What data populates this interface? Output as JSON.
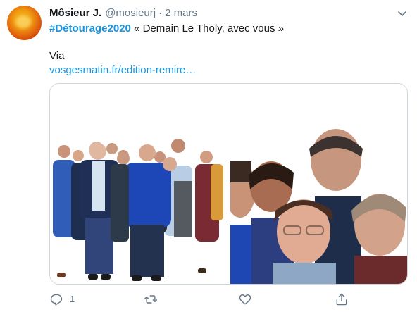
{
  "tweet": {
    "author_name": "Môsieur J.",
    "author_handle": "@mosieurj",
    "separator": "·",
    "date": "2 mars",
    "hashtag": "#Détourage2020",
    "text_after_hashtag": " « Demain Le Tholy, avec vous »",
    "via_text": "Via",
    "link_text": "vosgesmatin.fr/edition-remire…"
  },
  "actions": {
    "reply_count": "1",
    "reply_icon": "reply-icon",
    "retweet_icon": "retweet-icon",
    "like_icon": "heart-icon",
    "share_icon": "share-icon"
  },
  "media": {
    "left_photo": "group-cutout-photo",
    "right_photo": "group-closeup-photo"
  },
  "colors": {
    "accent": "#1b95e0",
    "secondary_text": "#657786",
    "primary_text": "#14171a",
    "border": "#ccd6dd"
  }
}
